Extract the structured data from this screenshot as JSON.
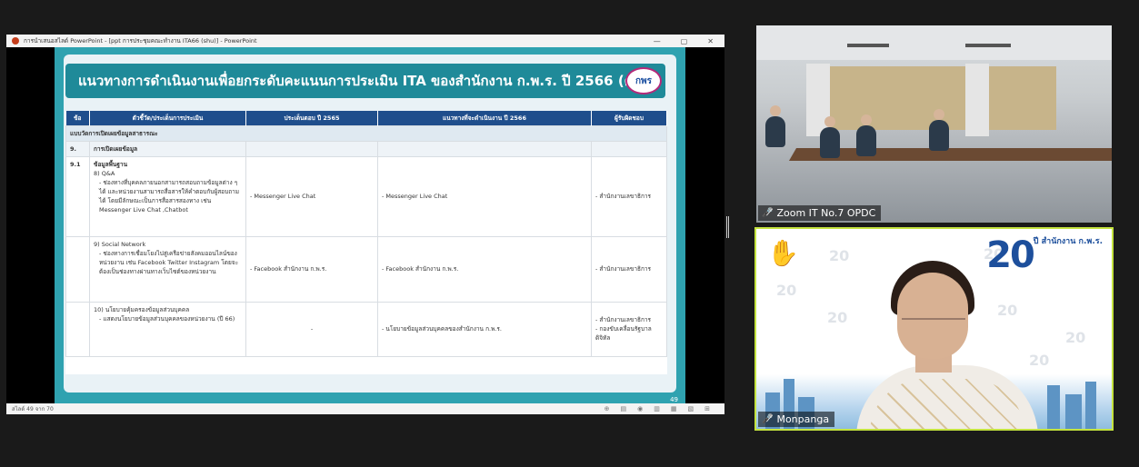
{
  "ppt": {
    "window_title": "การนำเสนอสไลด์ PowerPoint - [ppt การประชุมคณะทำงาน ITA66 (shu)] - PowerPoint",
    "win_minimize": "—",
    "win_restore": "▢",
    "win_close": "✕",
    "status_slide": "สไลด์ 49 จาก 70",
    "status_icons": [
      "⊕",
      "▤",
      "◉",
      "▥",
      "▦",
      "▧",
      "⊞"
    ]
  },
  "slide": {
    "title": "แนวทางการดำเนินงานเพื่อยกระดับคะแนนการประเมิน ITA ของสำนักงาน ก.พ.ร. ปี 2566 (ต่อ)",
    "logo_text": "กพร",
    "page_number": "49",
    "headers": [
      "ข้อ",
      "ตัวชี้วัด/ประเด็นการประเมิน",
      "ประเด็นตอบ ปี 2565",
      "แนวทางที่จะดำเนินงาน ปี 2566",
      "ผู้รับผิดชอบ"
    ],
    "section_row": "แบบวัดการเปิดเผยข้อมูลสาธารณะ",
    "sub_no": "9.",
    "sub_title": "การเปิดเผยข้อมูล",
    "row1": {
      "no": "9.1",
      "title": "ข้อมูลพื้นฐาน",
      "item": "8) Q&A",
      "detail": "- ช่องทางที่บุคคลภายนอกสามารถสอบถามข้อมูลต่าง ๆ ได้ และหน่วยงานสามารถสื่อสารให้คำตอบกับผู้สอบถามได้ โดยมีลักษณะเป็นการสื่อสารสองทาง เช่น Messenger Live Chat ,Chatbot",
      "c2565": "- Messenger Live Chat",
      "c2566": "- Messenger Live Chat",
      "owner": "- สำนักงานเลขาธิการ"
    },
    "row2": {
      "item": "9) Social Network",
      "detail": "- ช่องทางการเชื่อมโยงไปสู่เครือข่ายสังคมออนไลน์ของหน่วยงาน เช่น Facebook Twitter Instagram โดยจะต้องเป็นช่องทางผ่านทางเว็บไซต์ของหน่วยงาน",
      "c2565": "- Facebook สำนักงาน ก.พ.ร.",
      "c2566": "- Facebook สำนักงาน ก.พ.ร.",
      "owner": "- สำนักงานเลขาธิการ"
    },
    "row3": {
      "item": "10) นโยบายคุ้มครองข้อมูลส่วนบุคคล",
      "detail": "- แสดงนโยบายข้อมูลส่วนบุคคลของหน่วยงาน (ปี 66)",
      "c2565": "-",
      "c2566": "- นโยบายข้อมูลส่วนบุคคลของสำนักงาน ก.พ.ร.",
      "owner1": "- สำนักงานเลขาธิการ",
      "owner2": "- กองขับเคลื่อนรัฐบาลดิจิทัล"
    }
  },
  "participants": [
    {
      "name": "Zoom IT No.7 OPDC",
      "mic_icon": "mic-muted-icon"
    },
    {
      "name": "Monpanga",
      "mic_icon": "mic-muted-icon",
      "reaction": "✋"
    }
  ],
  "wm": [
    "20",
    "20",
    "20",
    "20",
    "20",
    "20",
    "20",
    "20"
  ],
  "logo20": {
    "big": "20",
    "small": "ปี สำนักงาน ก.พ.ร."
  },
  "colors": {
    "active_speaker_border": "#c4e33f",
    "slide_teal": "#2fa2b0",
    "table_header": "#1f4e8c"
  }
}
